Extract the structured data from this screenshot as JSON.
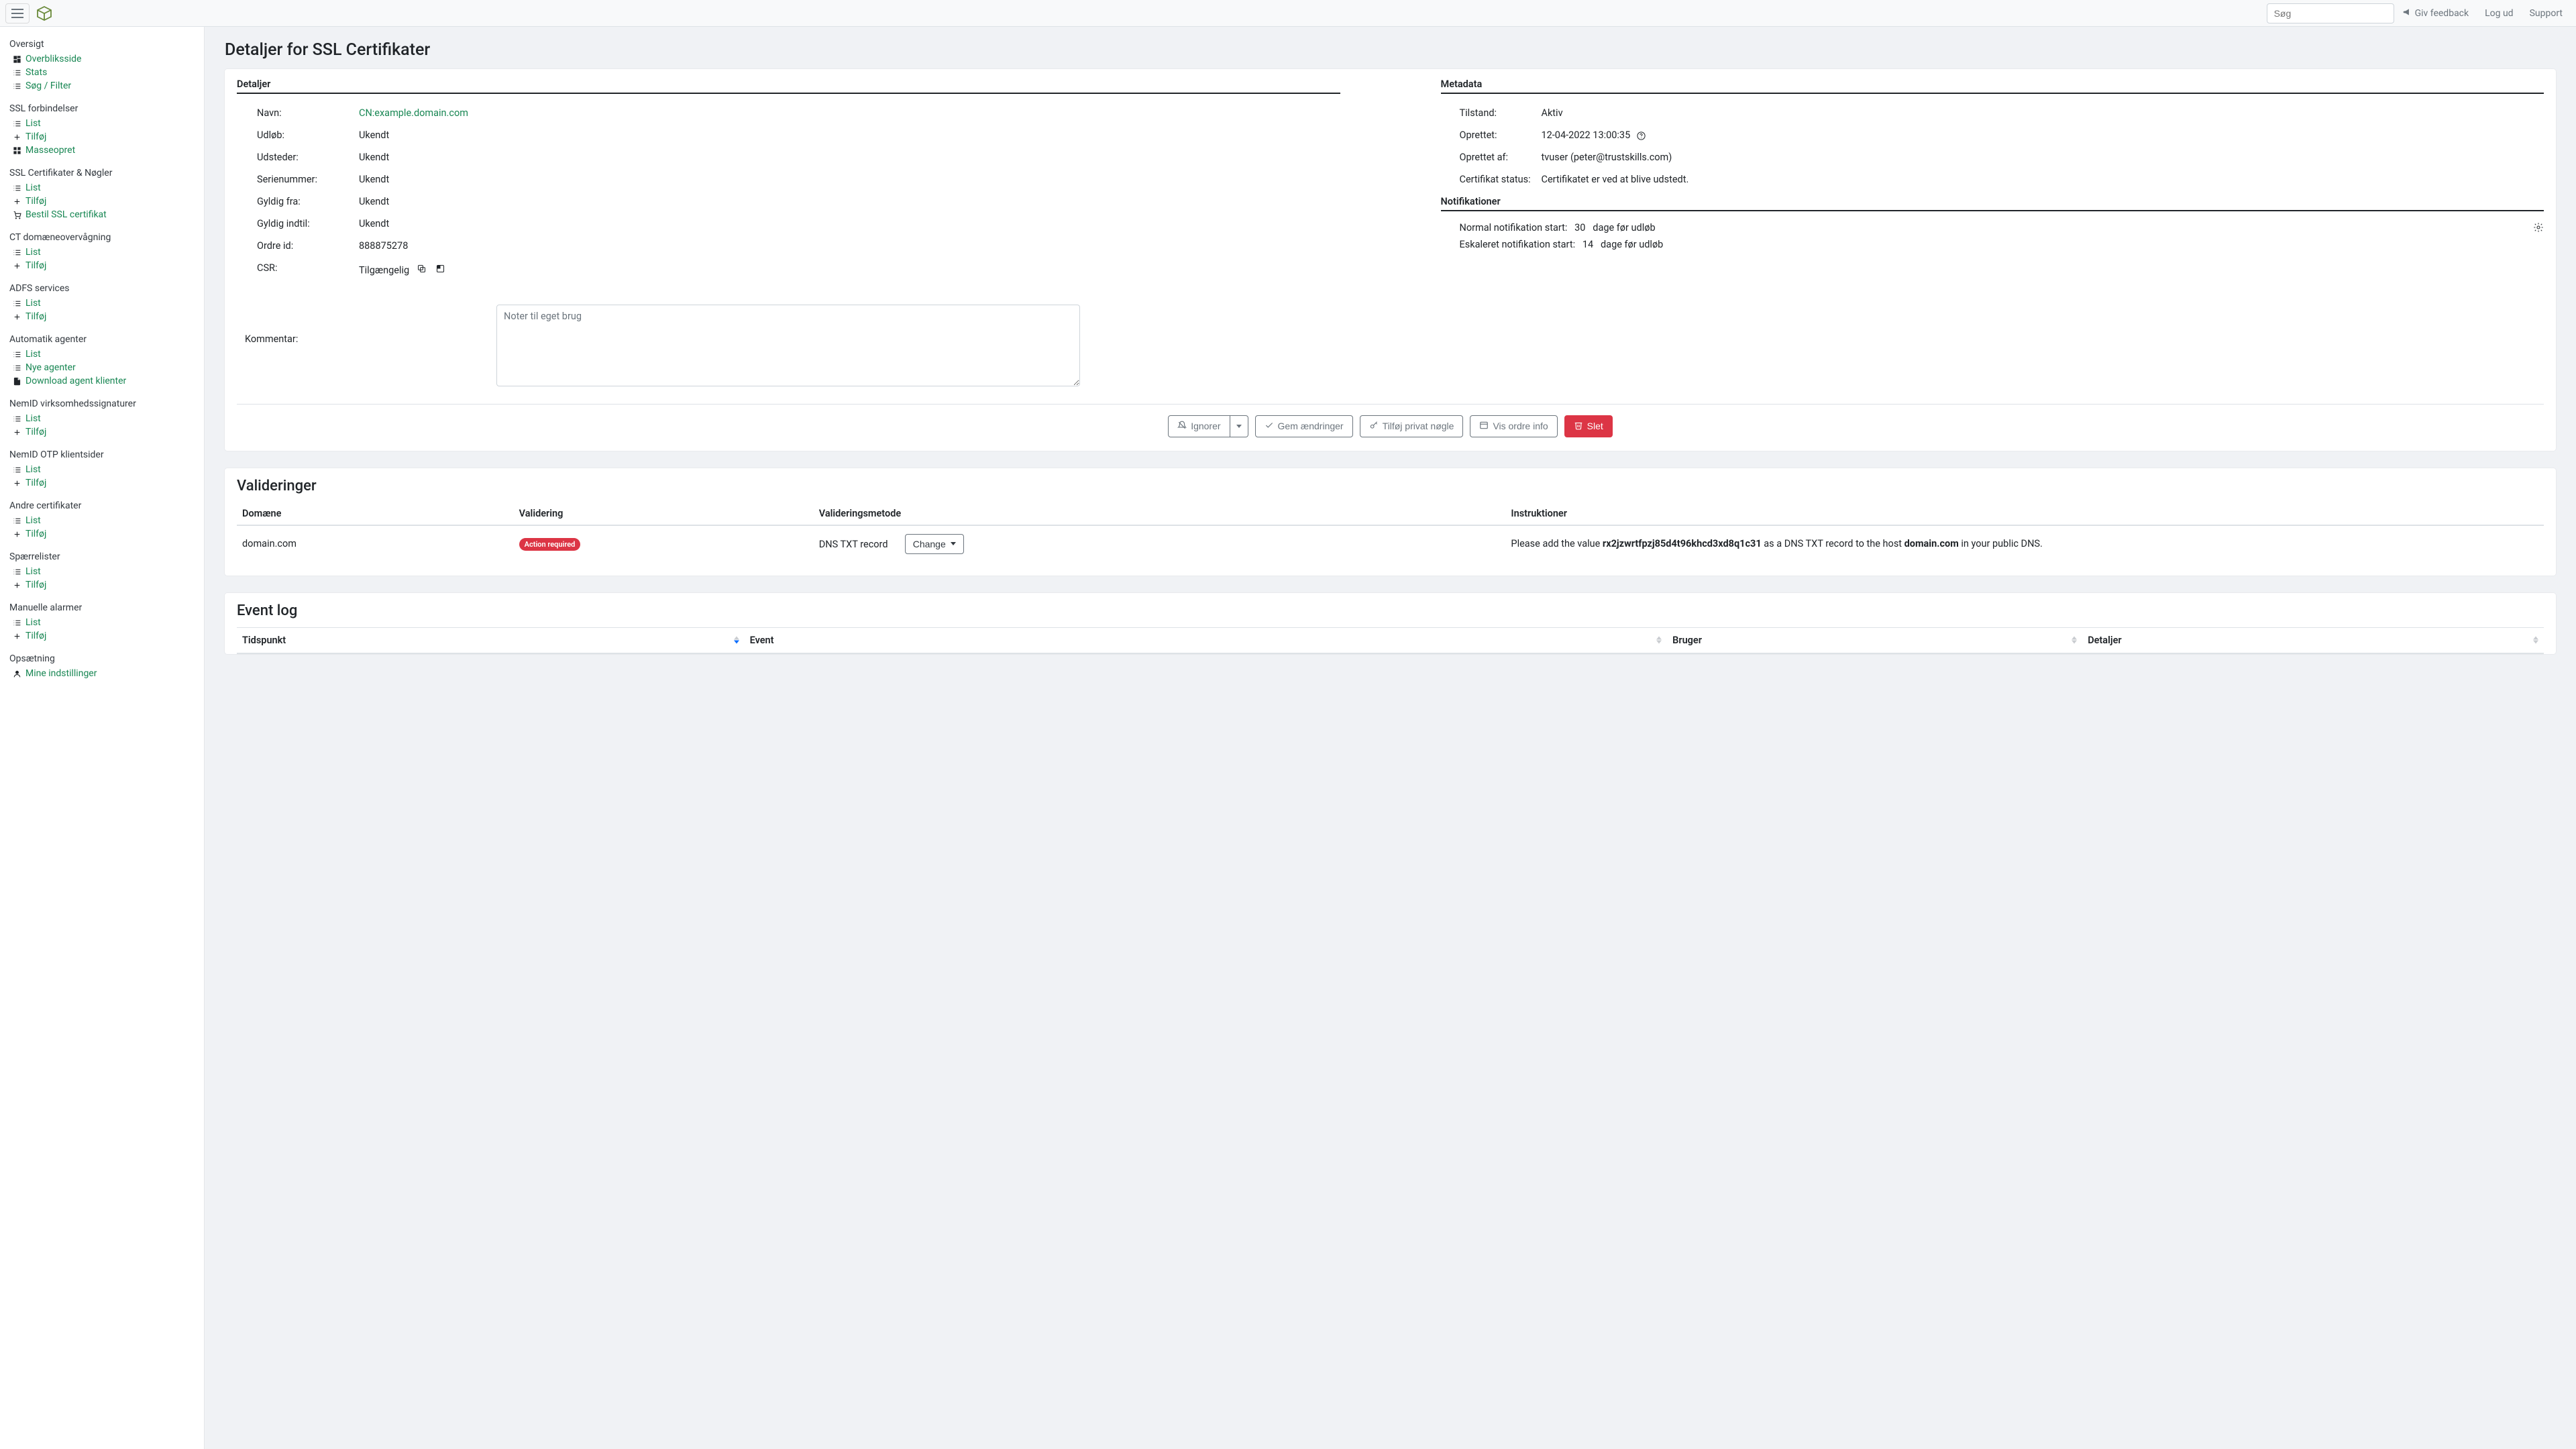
{
  "navbar": {
    "search_placeholder": "Søg",
    "feedback": "Giv feedback",
    "logout": "Log ud",
    "support": "Support"
  },
  "sidebar": {
    "sections": [
      {
        "title": "Oversigt",
        "items": [
          {
            "icon": "dashboard",
            "label": "Overbliksside"
          },
          {
            "icon": "list",
            "label": "Stats"
          },
          {
            "icon": "list",
            "label": "Søg / Filter"
          }
        ]
      },
      {
        "title": "SSL forbindelser",
        "items": [
          {
            "icon": "list",
            "label": "List"
          },
          {
            "icon": "plus",
            "label": "Tilføj"
          },
          {
            "icon": "grid",
            "label": "Masseopret"
          }
        ]
      },
      {
        "title": "SSL Certifikater & Nøgler",
        "items": [
          {
            "icon": "list",
            "label": "List"
          },
          {
            "icon": "plus",
            "label": "Tilføj"
          },
          {
            "icon": "cart",
            "label": "Bestil SSL certifikat"
          }
        ]
      },
      {
        "title": "CT domæneovervågning",
        "items": [
          {
            "icon": "list",
            "label": "List"
          },
          {
            "icon": "plus",
            "label": "Tilføj"
          }
        ]
      },
      {
        "title": "ADFS services",
        "items": [
          {
            "icon": "list",
            "label": "List"
          },
          {
            "icon": "plus",
            "label": "Tilføj"
          }
        ]
      },
      {
        "title": "Automatik agenter",
        "items": [
          {
            "icon": "list",
            "label": "List"
          },
          {
            "icon": "list",
            "label": "Nye agenter"
          },
          {
            "icon": "file",
            "label": "Download agent klienter"
          }
        ]
      },
      {
        "title": "NemID virksomhedssignaturer",
        "items": [
          {
            "icon": "list",
            "label": "List"
          },
          {
            "icon": "plus",
            "label": "Tilføj"
          }
        ]
      },
      {
        "title": "NemID OTP klientsider",
        "items": [
          {
            "icon": "list",
            "label": "List"
          },
          {
            "icon": "plus",
            "label": "Tilføj"
          }
        ]
      },
      {
        "title": "Andre certifikater",
        "items": [
          {
            "icon": "list",
            "label": "List"
          },
          {
            "icon": "plus",
            "label": "Tilføj"
          }
        ]
      },
      {
        "title": "Spærrelister",
        "items": [
          {
            "icon": "list",
            "label": "List"
          },
          {
            "icon": "plus",
            "label": "Tilføj"
          }
        ]
      },
      {
        "title": "Manuelle alarmer",
        "items": [
          {
            "icon": "list",
            "label": "List"
          },
          {
            "icon": "plus",
            "label": "Tilføj"
          }
        ]
      },
      {
        "title": "Opsætning",
        "items": [
          {
            "icon": "user",
            "label": "Mine indstillinger"
          }
        ]
      }
    ]
  },
  "page": {
    "title": "Detaljer for SSL Certifikater",
    "details_heading": "Detaljer",
    "metadata_heading": "Metadata",
    "notifications_heading": "Notifikationer",
    "details": {
      "name_label": "Navn:",
      "name_value": "CN:example.domain.com",
      "expiry_label": "Udløb:",
      "expiry_value": "Ukendt",
      "issuer_label": "Udsteder:",
      "issuer_value": "Ukendt",
      "serial_label": "Serienummer:",
      "serial_value": "Ukendt",
      "valid_from_label": "Gyldig fra:",
      "valid_from_value": "Ukendt",
      "valid_until_label": "Gyldig indtil:",
      "valid_until_value": "Ukendt",
      "order_id_label": "Ordre id:",
      "order_id_value": "888875278",
      "csr_label": "CSR:",
      "csr_value": "Tilgængelig"
    },
    "metadata": {
      "state_label": "Tilstand:",
      "state_value": "Aktiv",
      "created_label": "Oprettet:",
      "created_value": "12-04-2022 13:00:35",
      "created_by_label": "Oprettet af:",
      "created_by_value": "tvuser (peter@trustskills.com)",
      "cert_status_label": "Certifikat status:",
      "cert_status_value": "Certifikatet er ved at blive udstedt."
    },
    "notifications": {
      "normal_label": "Normal notifikation start:",
      "normal_days": "30",
      "escalated_label": "Eskaleret notifikation start:",
      "escalated_days": "14",
      "days_suffix": "dage før udløb"
    },
    "comment": {
      "label": "Kommentar:",
      "placeholder": "Noter til eget brug"
    },
    "buttons": {
      "ignore": "Ignorer",
      "save": "Gem ændringer",
      "add_pk": "Tilføj privat nøgle",
      "order_info": "Vis ordre info",
      "delete": "Slet"
    }
  },
  "validations": {
    "title": "Valideringer",
    "headers": {
      "domain": "Domæne",
      "validation": "Validering",
      "method": "Valideringsmetode",
      "instructions": "Instruktioner"
    },
    "row": {
      "domain": "domain.com",
      "badge": "Action required",
      "method": "DNS TXT record",
      "change_btn": "Change",
      "instr_prefix": "Please add the value ",
      "instr_value": "rx2jzwrtfpzj85d4t96khcd3xd8q1c31",
      "instr_mid": " as a DNS TXT record to the host ",
      "instr_host": "domain.com",
      "instr_suffix": " in your public DNS."
    }
  },
  "eventlog": {
    "title": "Event log",
    "headers": {
      "time": "Tidspunkt",
      "event": "Event",
      "user": "Bruger",
      "details": "Detaljer"
    }
  }
}
